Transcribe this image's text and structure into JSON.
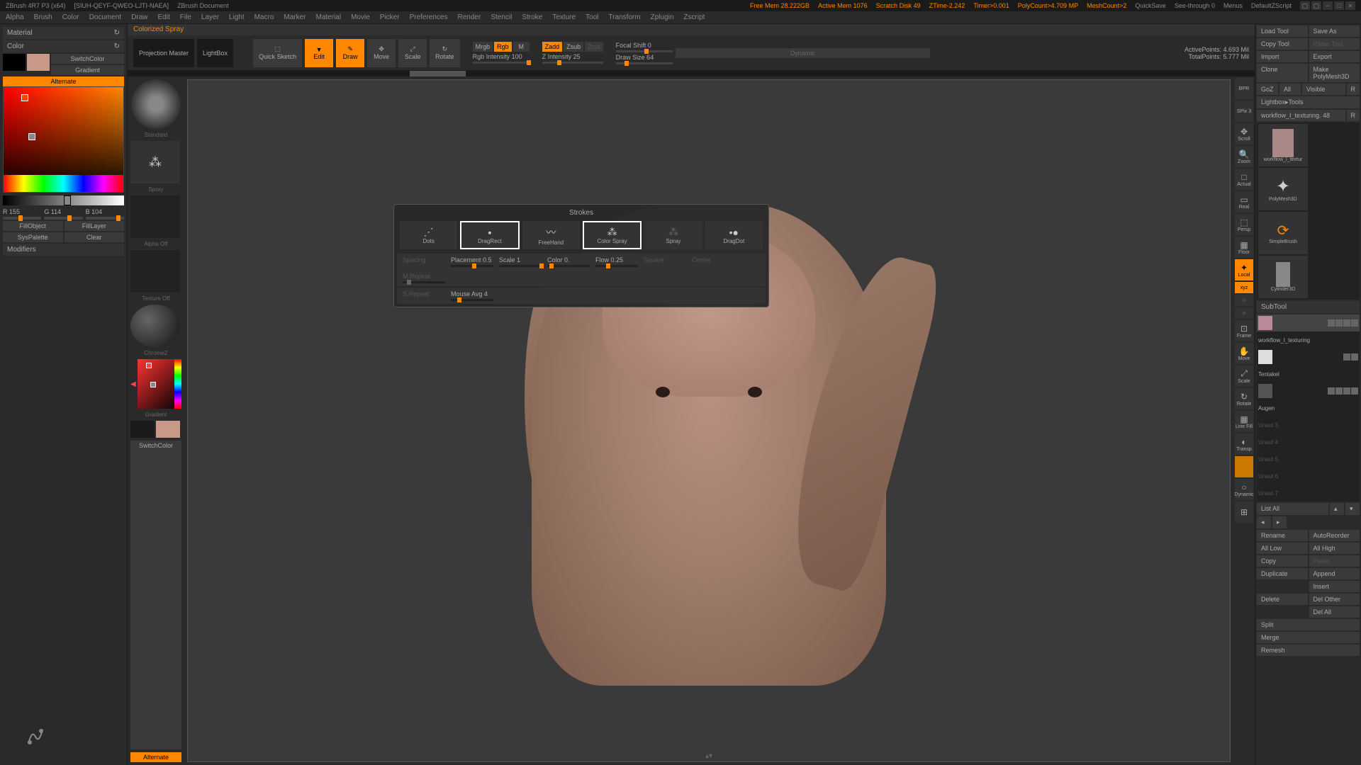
{
  "titlebar": {
    "app": "ZBrush 4R7 P3 (x64)",
    "doc_id": "[SIUH-QEYF-QWEO-LJTI-NAEA]",
    "doc": "ZBrush Document",
    "free_mem": "Free Mem 28.222GB",
    "active_mem": "Active Mem 1076",
    "scratch": "Scratch Disk 49",
    "ztime": "ZTime-2.242",
    "timer": "Timer>0.001",
    "polycount": "PolyCount>4.709 MP",
    "meshcount": "MeshCount>2",
    "quicksave": "QuickSave",
    "seethrough": "See-through  0",
    "menus": "Menus",
    "script": "DefaultZScript"
  },
  "menubar": {
    "items": [
      "Alpha",
      "Brush",
      "Color",
      "Document",
      "Draw",
      "Edit",
      "File",
      "Layer",
      "Light",
      "Macro",
      "Marker",
      "Material",
      "Movie",
      "Picker",
      "Preferences",
      "Render",
      "Stencil",
      "Stroke",
      "Texture",
      "Tool",
      "Transform",
      "Zplugin",
      "Zscript"
    ]
  },
  "left": {
    "material": "Material",
    "color": "Color",
    "switchcolor": "SwitchColor",
    "gradient": "Gradient",
    "alternate": "Alternate",
    "r": "R 155",
    "g": "G 114",
    "b": "B 104",
    "fillobject": "FillObject",
    "filllayer": "FillLayer",
    "syspalette": "SysPalette",
    "clear": "Clear",
    "modifiers": "Modifiers"
  },
  "status": "Colorized Spray",
  "toolbar": {
    "projection": "Projection Master",
    "lightbox": "LightBox",
    "quicksketch": "Quick Sketch",
    "edit": "Edit",
    "draw": "Draw",
    "move": "Move",
    "scale": "Scale",
    "rotate": "Rotate",
    "mrgb": "Mrgb",
    "rgb": "Rgb",
    "m": "M",
    "rgb_intensity": "Rgb Intensity 100",
    "zadd": "Zadd",
    "zsub": "Zsub",
    "zcut": "Zcut",
    "z_intensity": "Z Intensity 25",
    "focal_shift": "Focal Shift 0",
    "draw_size": "Draw Size 64",
    "dynamic": "Dynamic",
    "activepoints": "ActivePoints: 4.693 Mil",
    "totalpoints": "TotalPoints: 5.777 Mil"
  },
  "brush_panel": {
    "standard": "Standard",
    "spray": "Spray",
    "alpha_off": "Alpha Off",
    "texture_off": "Texture Off",
    "chrome": "ChromeZ",
    "gradient": "Gradient",
    "switchcolor": "SwitchColor",
    "alternate": "Alternate"
  },
  "strokes": {
    "title": "Strokes",
    "items": [
      "Dots",
      "DragRect",
      "FreeHand",
      "Color Spray",
      "Spray",
      "DragDot"
    ],
    "selected": 3,
    "spacing": "Spacing",
    "placement": "Placement 0.5",
    "scale": "Scale 1",
    "color": "Color 0.",
    "flow": "Flow 0.25",
    "square": "Square",
    "center": "Center",
    "mrepeat": "M.Repeat",
    "srepeat": "S.Repeat",
    "mouse_avg": "Mouse Avg 4"
  },
  "nav": {
    "items": [
      "BPR",
      "SPix 3",
      "Scroll",
      "Zoom",
      "Actual",
      "Real",
      "Persp",
      "Floor",
      "Local",
      "xyz",
      "Frame",
      "Move",
      "Scale",
      "Rotate",
      "Line Fill",
      "Transp",
      "",
      "Dynamic",
      ""
    ]
  },
  "right": {
    "load_tool": "Load Tool",
    "save_as": "Save As",
    "copy_tool": "Copy Tool",
    "paste_tool": "Paste Tool",
    "import": "Import",
    "export": "Export",
    "clone": "Clone",
    "make_polymesh": "Make PolyMesh3D",
    "goz": "GoZ",
    "all": "All",
    "visible": "Visible",
    "r": "R",
    "lightbox_tools": "Lightbox▸Tools",
    "tool_name": "workflow_I_texturing. 48",
    "subtool": "SubTool",
    "subtools": [
      "workflow_I_texturing",
      "",
      "Tentakel",
      "",
      "Augen",
      "Unaut 3",
      "Unaut 4",
      "Unaut 5",
      "Unaut 6",
      "Unaut 7"
    ],
    "list_all": "List All",
    "rename": "Rename",
    "autoreorder": "AutoReorder",
    "all_low": "All Low",
    "all_high": "All High",
    "copy": "Copy",
    "paste": "Paste",
    "duplicate": "Duplicate",
    "append": "Append",
    "insert": "Insert",
    "delete": "Delete",
    "del_other": "Del Other",
    "del_all": "Del All",
    "split": "Split",
    "merge": "Merge",
    "remesh": "Remesh"
  }
}
